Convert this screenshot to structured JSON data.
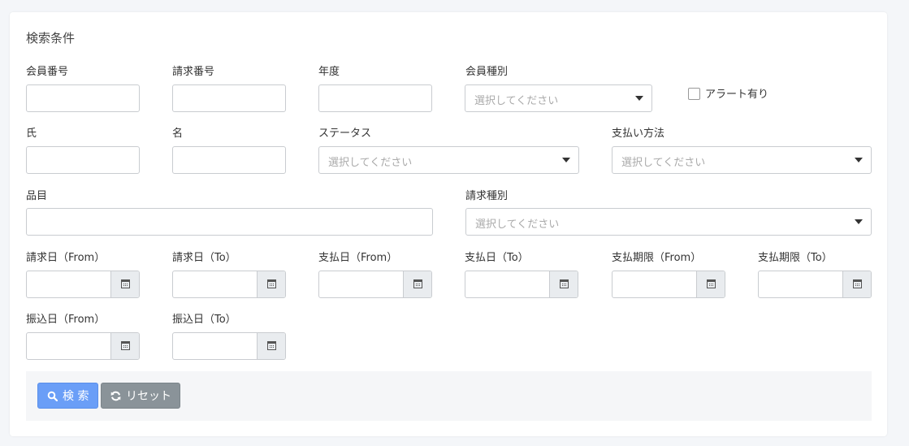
{
  "card": {
    "title": "検索条件"
  },
  "fields": {
    "member_no": "会員番号",
    "invoice_no": "請求番号",
    "year": "年度",
    "member_type": "会員種別",
    "alert": "アラート有り",
    "last_name": "氏",
    "first_name": "名",
    "status": "ステータス",
    "payment_method": "支払い方法",
    "item": "品目",
    "invoice_type": "請求種別",
    "invoice_date_from": "請求日（From）",
    "invoice_date_to": "請求日（To）",
    "pay_date_from": "支払日（From）",
    "pay_date_to": "支払日（To）",
    "pay_due_from": "支払期限（From）",
    "pay_due_to": "支払期限（To）",
    "transfer_date_from": "振込日（From）",
    "transfer_date_to": "振込日（To）"
  },
  "placeholder": "選択してください",
  "buttons": {
    "search": "検 索",
    "reset": "リセット"
  },
  "icons": {
    "search": "search-icon",
    "reset": "refresh-icon",
    "calendar": "calendar-icon"
  },
  "colors": {
    "primary": "#6a9ef7",
    "secondary": "#8a9399"
  }
}
